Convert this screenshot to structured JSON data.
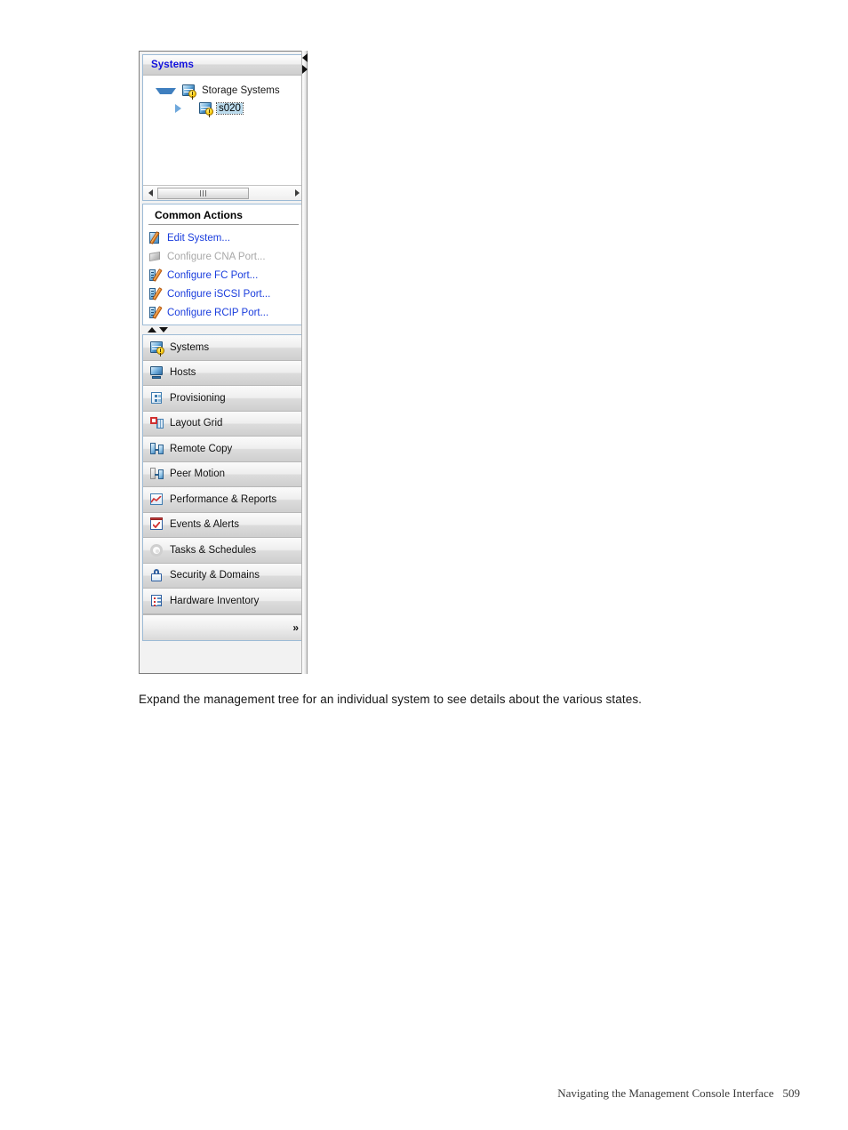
{
  "panel": {
    "tree_section": {
      "header_title": "Systems",
      "nodes": [
        {
          "label": "Storage Systems",
          "level": 0,
          "expanded": true,
          "icon": "storage-system-warning-icon",
          "selected": false
        },
        {
          "label": "s020",
          "level": 1,
          "expanded": false,
          "icon": "storage-system-warning-icon",
          "selected": true
        }
      ],
      "scrollbar": {
        "left_arrow": "◀",
        "right_arrow": "▶",
        "grip": "|||"
      }
    },
    "common_actions": {
      "title": "Common Actions",
      "items": [
        {
          "label": "Edit System...",
          "icon": "edit-system-icon",
          "enabled": true
        },
        {
          "label": "Configure CNA Port...",
          "icon": "configure-cna-port-icon",
          "enabled": false
        },
        {
          "label": "Configure FC Port...",
          "icon": "configure-fc-port-icon",
          "enabled": true
        },
        {
          "label": "Configure iSCSI Port...",
          "icon": "configure-iscsi-port-icon",
          "enabled": true
        },
        {
          "label": "Configure RCIP Port...",
          "icon": "configure-rcip-port-icon",
          "enabled": true
        }
      ],
      "scroll_up": "▲",
      "scroll_down": "▼"
    },
    "navigation": {
      "items": [
        {
          "label": "Systems",
          "icon": "systems-icon"
        },
        {
          "label": "Hosts",
          "icon": "hosts-icon"
        },
        {
          "label": "Provisioning",
          "icon": "provisioning-icon"
        },
        {
          "label": "Layout Grid",
          "icon": "layout-grid-icon"
        },
        {
          "label": "Remote Copy",
          "icon": "remote-copy-icon"
        },
        {
          "label": "Peer Motion",
          "icon": "peer-motion-icon"
        },
        {
          "label": "Performance & Reports",
          "icon": "performance-reports-icon"
        },
        {
          "label": "Events & Alerts",
          "icon": "events-alerts-icon"
        },
        {
          "label": "Tasks & Schedules",
          "icon": "tasks-schedules-icon"
        },
        {
          "label": "Security & Domains",
          "icon": "security-domains-icon"
        },
        {
          "label": "Hardware Inventory",
          "icon": "hardware-inventory-icon"
        }
      ],
      "expand_chevron": "»"
    },
    "splitter": {
      "collapse_left_arrow": "◀",
      "expand_right_arrow": "▶"
    },
    "colors": {
      "header_title": "#1111dd",
      "action_link": "#1a3ddd",
      "action_disabled": "#a8a8a8",
      "selection_highlight": "#bcdcee",
      "panel_border": "#9dbbd6"
    }
  },
  "page": {
    "paragraph": "Expand the management tree for an individual system to see details about the various states.",
    "footer_title": "Navigating the Management Console Interface",
    "footer_page_number": "509"
  }
}
